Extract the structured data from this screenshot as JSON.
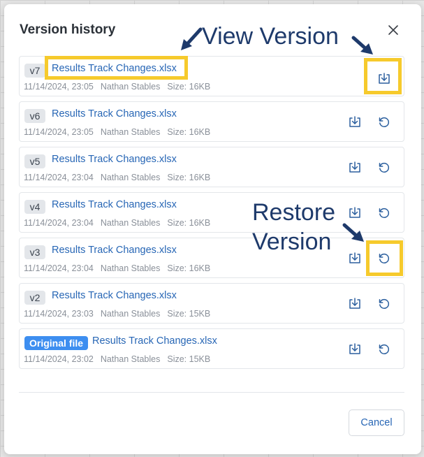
{
  "dialog": {
    "title": "Version history",
    "close_icon": "close-icon",
    "cancel_label": "Cancel"
  },
  "versions": [
    {
      "label": "v7",
      "filename": "Results Track Changes.xlsx",
      "date": "11/14/2024, 23:05",
      "author": "Nathan Stables",
      "size": "Size: 16KB",
      "has_restore": false
    },
    {
      "label": "v6",
      "filename": "Results Track Changes.xlsx",
      "date": "11/14/2024, 23:05",
      "author": "Nathan Stables",
      "size": "Size: 16KB",
      "has_restore": true
    },
    {
      "label": "v5",
      "filename": "Results Track Changes.xlsx",
      "date": "11/14/2024, 23:04",
      "author": "Nathan Stables",
      "size": "Size: 16KB",
      "has_restore": true
    },
    {
      "label": "v4",
      "filename": "Results Track Changes.xlsx",
      "date": "11/14/2024, 23:04",
      "author": "Nathan Stables",
      "size": "Size: 16KB",
      "has_restore": true
    },
    {
      "label": "v3",
      "filename": "Results Track Changes.xlsx",
      "date": "11/14/2024, 23:04",
      "author": "Nathan Stables",
      "size": "Size: 16KB",
      "has_restore": true
    },
    {
      "label": "v2",
      "filename": "Results Track Changes.xlsx",
      "date": "11/14/2024, 23:03",
      "author": "Nathan Stables",
      "size": "Size: 15KB",
      "has_restore": true
    },
    {
      "label": "Original file",
      "filename": "Results Track Changes.xlsx",
      "date": "11/14/2024, 23:02",
      "author": "Nathan Stables",
      "size": "Size: 15KB",
      "has_restore": true
    }
  ],
  "icons": {
    "view": "download-view-icon",
    "restore": "restore-icon"
  },
  "annotations": {
    "view_version": "View Version",
    "restore_line1": "Restore",
    "restore_line2": "Version"
  },
  "colors": {
    "highlight": "#f6ca2c",
    "annotation": "#1e3a6b",
    "link": "#2766b5",
    "original_badge": "#3d8ef0"
  }
}
